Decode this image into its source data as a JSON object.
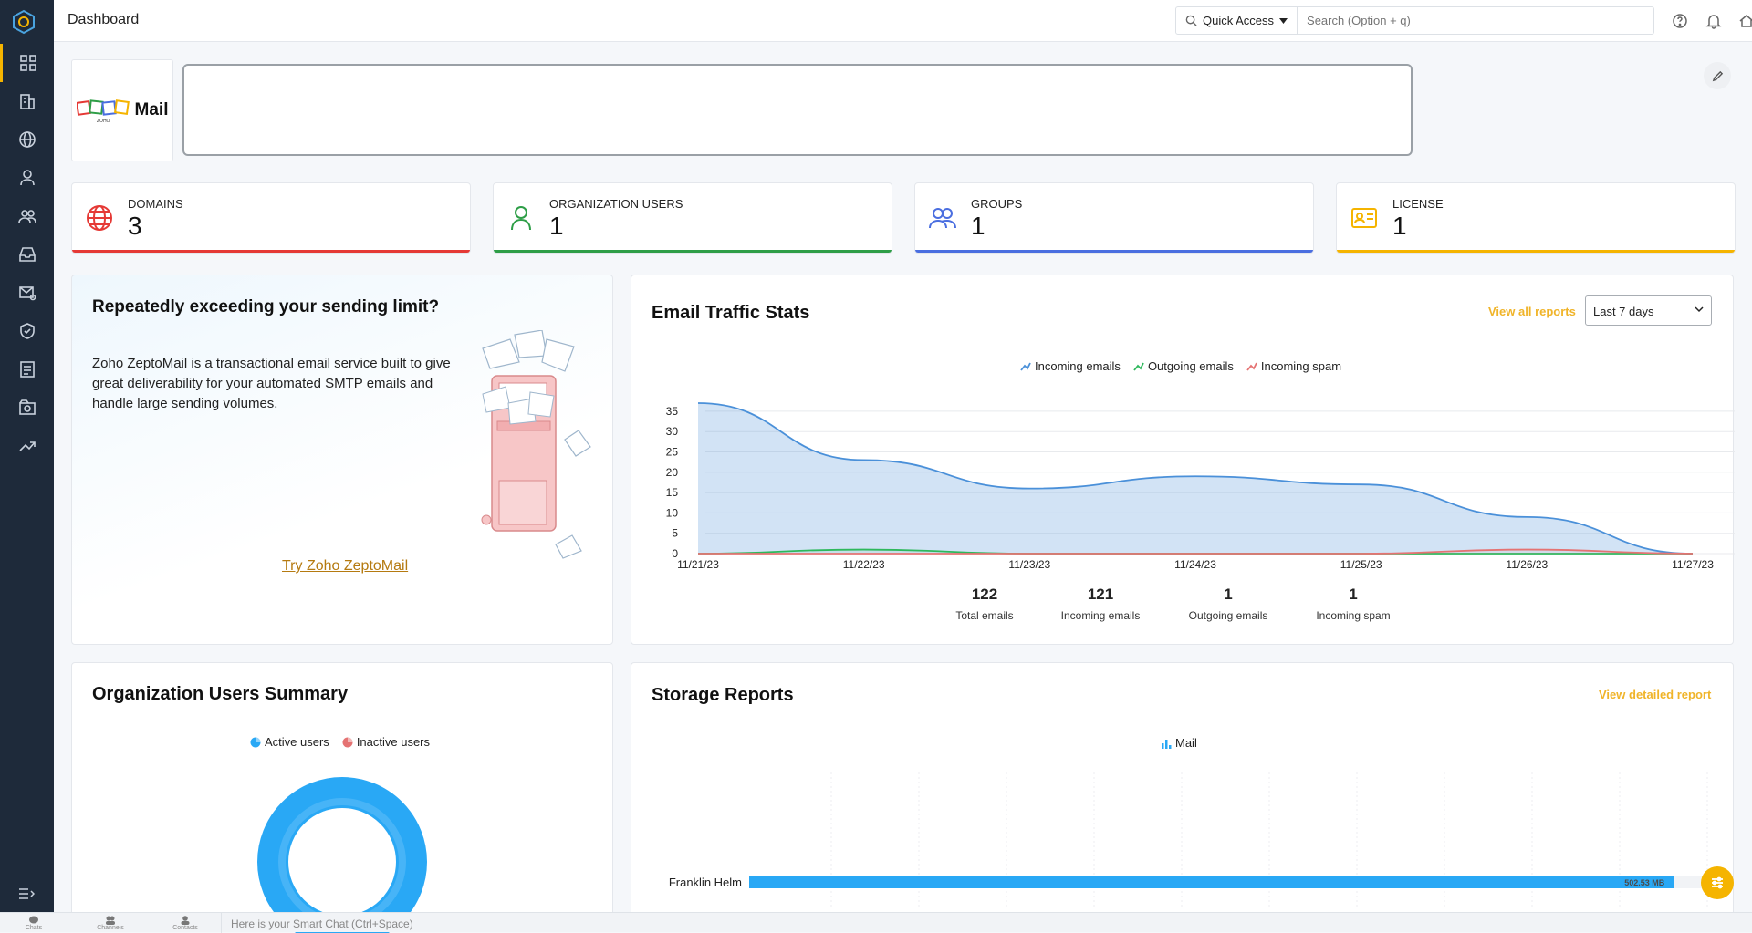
{
  "header": {
    "title": "Dashboard",
    "quick_access": "Quick Access",
    "search_placeholder": "Search (Option + q)"
  },
  "sidebar": {
    "items": [
      "dashboard",
      "organization",
      "domains",
      "users",
      "groups",
      "mail-policy",
      "mail-settings",
      "security",
      "reports",
      "data-administration",
      "analytics"
    ]
  },
  "brand": {
    "logo_label": "ZOHO",
    "app_name": "Mail"
  },
  "stats": [
    {
      "label": "DOMAINS",
      "value": "3",
      "color": "#e53935",
      "icon": "globe-icon"
    },
    {
      "label": "ORGANIZATION USERS",
      "value": "1",
      "color": "#2e9e47",
      "icon": "user-icon"
    },
    {
      "label": "GROUPS",
      "value": "1",
      "color": "#4a6ee0",
      "icon": "group-icon"
    },
    {
      "label": "LICENSE",
      "value": "1",
      "color": "#f5b400",
      "icon": "license-icon"
    }
  ],
  "promo": {
    "title": "Repeatedly exceeding your sending limit?",
    "body": "Zoho ZeptoMail is a transactional email service built to give great deliverability for your automated SMTP emails and handle large sending volumes.",
    "link": "Try Zoho ZeptoMail"
  },
  "traffic": {
    "title": "Email Traffic Stats",
    "view_all": "View all reports",
    "range": "Last 7 days",
    "summary": [
      {
        "value": "122",
        "label": "Total emails"
      },
      {
        "value": "121",
        "label": "Incoming emails"
      },
      {
        "value": "1",
        "label": "Outgoing emails"
      },
      {
        "value": "1",
        "label": "Incoming spam"
      }
    ]
  },
  "chart_data": [
    {
      "type": "area",
      "x": [
        "11/21/23",
        "11/22/23",
        "11/23/23",
        "11/24/23",
        "11/25/23",
        "11/26/23",
        "11/27/23"
      ],
      "yticks": [
        0,
        5,
        10,
        15,
        20,
        25,
        30,
        35
      ],
      "ylim": [
        0,
        37
      ],
      "grid": true,
      "legend_position": "top-center",
      "series": [
        {
          "name": "Incoming emails",
          "values": [
            37,
            23,
            16,
            19,
            17,
            9,
            0
          ],
          "color": "#4a90d9"
        },
        {
          "name": "Outgoing emails",
          "values": [
            0,
            1,
            0,
            0,
            0,
            0,
            0
          ],
          "color": "#2eb85c"
        },
        {
          "name": "Incoming spam",
          "values": [
            0,
            0,
            0,
            0,
            0,
            1,
            0
          ],
          "color": "#e57373"
        }
      ]
    },
    {
      "type": "pie",
      "title": "Organization Users Summary",
      "legend_position": "top-center",
      "series": [
        {
          "name": "Active users",
          "values": [
            1
          ],
          "color": "#29a8f5"
        },
        {
          "name": "Inactive users",
          "values": [
            0
          ],
          "color": "#e57373"
        }
      ]
    },
    {
      "type": "bar",
      "title": "Storage Reports",
      "legend_position": "top-center",
      "categories": [
        "Franklin Helm"
      ],
      "series": [
        {
          "name": "Mail",
          "values": [
            502.53
          ],
          "color": "#29a8f5"
        }
      ],
      "data_labels": [
        "502.53 MB"
      ],
      "fill_fraction": 0.965
    }
  ],
  "users_card": {
    "title": "Organization Users Summary"
  },
  "storage_card": {
    "title": "Storage Reports",
    "view_link": "View detailed report"
  },
  "chatbar": {
    "tabs": [
      "Chats",
      "Channels",
      "Contacts"
    ],
    "placeholder": "Here is your Smart Chat (Ctrl+Space)"
  }
}
